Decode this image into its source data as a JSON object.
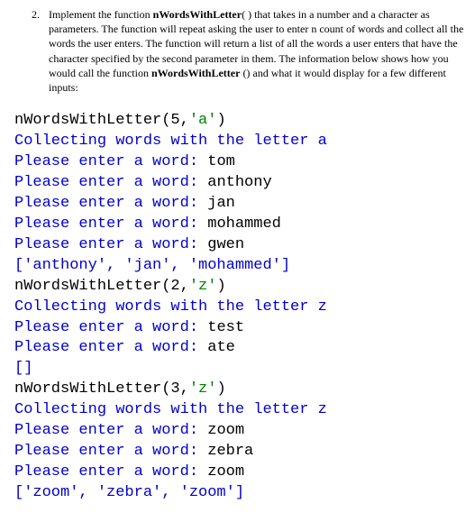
{
  "question": {
    "number": "2.",
    "text_parts": [
      "Implement the function ",
      "nWordsWithLetter",
      "( ) that takes in a number and a character as parameters.  The function will repeat asking the user to enter n count of words and collect all the words the user enters. The function will return a list of all the words a user enters that have the character specified by the second parameter in them. The information below shows how you would call the function ",
      "nWordsWithLetter",
      " () and what it would display for a few different inputs:"
    ]
  },
  "console_lines": [
    {
      "segments": [
        {
          "cls": "c-black",
          "text": "nWordsWithLetter(5,"
        },
        {
          "cls": "c-green",
          "text": "'a'"
        },
        {
          "cls": "c-black",
          "text": ")"
        }
      ]
    },
    {
      "segments": [
        {
          "cls": "c-blue",
          "text": "Collecting words with the letter a"
        }
      ]
    },
    {
      "segments": [
        {
          "cls": "c-blue",
          "text": "Please enter a word: "
        },
        {
          "cls": "c-black",
          "text": "tom"
        }
      ]
    },
    {
      "segments": [
        {
          "cls": "c-blue",
          "text": "Please enter a word: "
        },
        {
          "cls": "c-black",
          "text": "anthony"
        }
      ]
    },
    {
      "segments": [
        {
          "cls": "c-blue",
          "text": "Please enter a word: "
        },
        {
          "cls": "c-black",
          "text": "jan"
        }
      ]
    },
    {
      "segments": [
        {
          "cls": "c-blue",
          "text": "Please enter a word: "
        },
        {
          "cls": "c-black",
          "text": "mohammed"
        }
      ]
    },
    {
      "segments": [
        {
          "cls": "c-blue",
          "text": "Please enter a word: "
        },
        {
          "cls": "c-black",
          "text": "gwen"
        }
      ]
    },
    {
      "segments": [
        {
          "cls": "c-blue",
          "text": "['anthony', 'jan', 'mohammed']"
        }
      ]
    },
    {
      "segments": [
        {
          "cls": "c-black",
          "text": "nWordsWithLetter(2,"
        },
        {
          "cls": "c-green",
          "text": "'z'"
        },
        {
          "cls": "c-black",
          "text": ")"
        }
      ]
    },
    {
      "segments": [
        {
          "cls": "c-blue",
          "text": "Collecting words with the letter z"
        }
      ]
    },
    {
      "segments": [
        {
          "cls": "c-blue",
          "text": "Please enter a word: "
        },
        {
          "cls": "c-black",
          "text": "test"
        }
      ]
    },
    {
      "segments": [
        {
          "cls": "c-blue",
          "text": "Please enter a word: "
        },
        {
          "cls": "c-black",
          "text": "ate"
        }
      ]
    },
    {
      "segments": [
        {
          "cls": "c-blue",
          "text": "[]"
        }
      ]
    },
    {
      "segments": [
        {
          "cls": "c-black",
          "text": "nWordsWithLetter(3,"
        },
        {
          "cls": "c-green",
          "text": "'z'"
        },
        {
          "cls": "c-black",
          "text": ")"
        }
      ]
    },
    {
      "segments": [
        {
          "cls": "c-blue",
          "text": "Collecting words with the letter z"
        }
      ]
    },
    {
      "segments": [
        {
          "cls": "c-blue",
          "text": "Please enter a word: "
        },
        {
          "cls": "c-black",
          "text": "zoom"
        }
      ]
    },
    {
      "segments": [
        {
          "cls": "c-blue",
          "text": "Please enter a word: "
        },
        {
          "cls": "c-black",
          "text": "zebra"
        }
      ]
    },
    {
      "segments": [
        {
          "cls": "c-blue",
          "text": "Please enter a word: "
        },
        {
          "cls": "c-black",
          "text": "zoom"
        }
      ]
    },
    {
      "segments": [
        {
          "cls": "c-blue",
          "text": "['zoom', 'zebra', 'zoom']"
        }
      ]
    }
  ]
}
